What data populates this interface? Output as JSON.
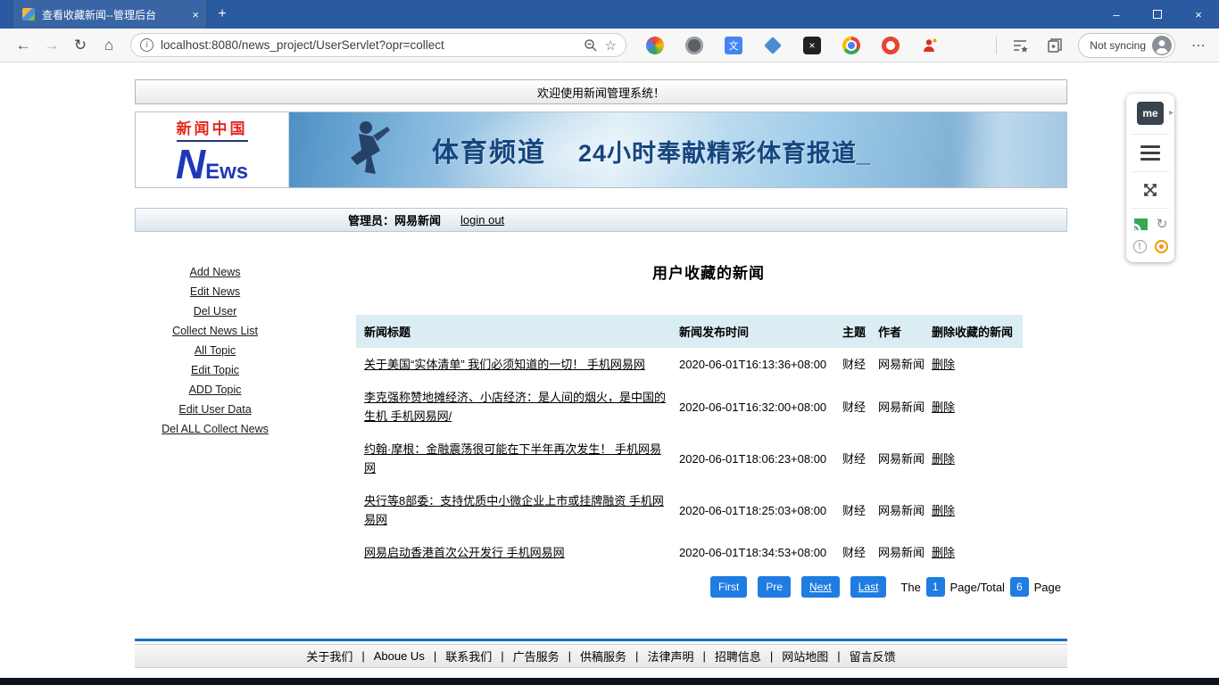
{
  "colors": {
    "titlebar": "#2a5a9f",
    "btn-blue": "#1e7ce2",
    "thead-bg": "#daedf2",
    "footer-line": "#1570c8",
    "banner-text": "#16457f",
    "logo-red": "#e02b20",
    "logo-blue": "#2038b8"
  },
  "icons": {
    "back": "←",
    "forward": "→",
    "refresh": "↻",
    "home": "⌂",
    "star": "☆",
    "more": "⋯",
    "new_tab": "+",
    "tab_close": "×",
    "minimize": "–",
    "close": "×",
    "me_arrow": "▸",
    "panel_refresh": "↻",
    "panel_info": "!",
    "translate": "文",
    "ext_x": "×"
  },
  "browser": {
    "tab_title": "查看收藏新闻--管理后台",
    "url": "localhost:8080/news_project/UserServlet?opr=collect",
    "profile_label": "Not syncing"
  },
  "page": {
    "welcome": "欢迎使用新闻管理系统！",
    "logo": {
      "line1": "新闻中国",
      "n": "N",
      "ews": "Ews"
    },
    "banner": {
      "title": "体育频道",
      "subtitle": "24小时奉献精彩体育报道_"
    },
    "admin": {
      "label": "管理员：网易新闻",
      "logout": "login out"
    },
    "sidebar": {
      "items": [
        "Add News",
        "Edit News",
        "Del User",
        "Collect News List",
        "All Topic",
        "Edit Topic",
        "ADD Topic",
        "Edit User Data",
        "Del ALL Collect News"
      ]
    },
    "main": {
      "title": "用户收藏的新闻",
      "table": {
        "headers": [
          "新闻标题",
          "新闻发布时间",
          "主题",
          "作者",
          "删除收藏的新闻"
        ],
        "rows": [
          {
            "title": "关于美国“实体清单” 我们必须知道的一切！ 手机网易网",
            "time": "2020-06-01T16:13:36+08:00",
            "topic": "财经",
            "author": "网易新闻",
            "action": "删除"
          },
          {
            "title": "李克强称赞地摊经济、小店经济：是人间的烟火，是中国的生机 手机网易网/",
            "time": "2020-06-01T16:32:00+08:00",
            "topic": "财经",
            "author": "网易新闻",
            "action": "删除"
          },
          {
            "title": "约翰·摩根：金融震荡很可能在下半年再次发生！ 手机网易网",
            "time": "2020-06-01T18:06:23+08:00",
            "topic": "财经",
            "author": "网易新闻",
            "action": "删除"
          },
          {
            "title": "央行等8部委：支持优质中小微企业上市或挂牌融资 手机网易网",
            "time": "2020-06-01T18:25:03+08:00",
            "topic": "财经",
            "author": "网易新闻",
            "action": "删除"
          },
          {
            "title": "网易启动香港首次公开发行 手机网易网",
            "time": "2020-06-01T18:34:53+08:00",
            "topic": "财经",
            "author": "网易新闻",
            "action": "删除"
          }
        ]
      },
      "pagination": {
        "first": "First",
        "pre": "Pre",
        "next": "Next",
        "last": "Last",
        "prefix": "The",
        "current": "1",
        "middle": "Page/Total",
        "total": "6",
        "suffix": "Page"
      }
    },
    "footer": {
      "separator": "|",
      "links": [
        "关于我们",
        "Aboue Us",
        "联系我们",
        "广告服务",
        "供稿服务",
        "法律声明",
        "招聘信息",
        "网站地图",
        "留言反馈"
      ]
    },
    "panel": {
      "me": "me"
    }
  }
}
